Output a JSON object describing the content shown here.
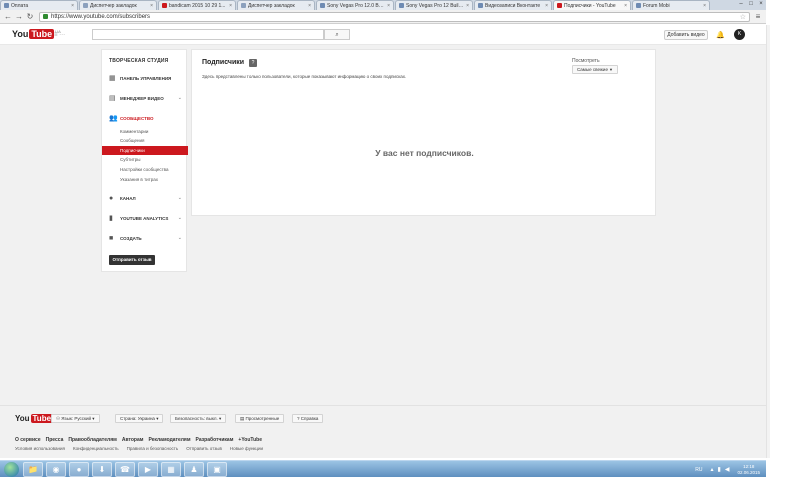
{
  "browser": {
    "tabs": [
      {
        "label": "Оплата",
        "icon": "generic",
        "active": false
      },
      {
        "label": "Диспетчер закладок",
        "icon": "star",
        "active": false
      },
      {
        "label": "bandicam 2015 10 29 1...",
        "icon": "yt",
        "active": false
      },
      {
        "label": "Диспетчер закладок",
        "icon": "star",
        "active": false
      },
      {
        "label": "Sony Vegas Pro 12.0 Build...",
        "icon": "generic",
        "active": false
      },
      {
        "label": "Sony Vegas Pro 12 Build...",
        "icon": "generic",
        "active": false
      },
      {
        "label": "Видеозаписи Вконтакте",
        "icon": "generic",
        "active": false
      },
      {
        "label": "Подписчики - YouTube",
        "icon": "yt",
        "active": true
      },
      {
        "label": "Forum Mobi",
        "icon": "generic",
        "active": false
      }
    ],
    "url": "https://www.youtube.com/subscribers",
    "tab_close": "×"
  },
  "masthead": {
    "logo_you": "You",
    "logo_tube": "Tube",
    "logo_region": "UA",
    "guide": "≡ ···",
    "search_icon": "⌕",
    "upload_label": "Добавить видео",
    "bell_icon": "🔔",
    "avatar_letter": "K"
  },
  "sidebar": {
    "studio_title": "ТВОРЧЕСКАЯ СТУДИЯ",
    "sections": [
      {
        "label": "ПАНЕЛЬ УПРАВЛЕНИЯ",
        "icon": "dashboard-icon",
        "glyph": "▦",
        "chevron": ""
      },
      {
        "label": "МЕНЕДЖЕР ВИДЕО",
        "icon": "video-manager-icon",
        "glyph": "▤",
        "chevron": "⌄"
      },
      {
        "label": "СООБЩЕСТВО",
        "icon": "community-icon",
        "glyph": "👥",
        "chevron": ""
      },
      {
        "label": "КАНАЛ",
        "icon": "channel-icon",
        "glyph": "●",
        "chevron": "⌄"
      },
      {
        "label": "YOUTUBE ANALYTICS",
        "icon": "analytics-icon",
        "glyph": "▮",
        "chevron": "⌄"
      },
      {
        "label": "СОЗДАТЬ",
        "icon": "create-icon",
        "glyph": "■",
        "chevron": "⌄"
      }
    ],
    "community_items": [
      {
        "label": "Комментарии",
        "active": false
      },
      {
        "label": "Сообщения",
        "active": false
      },
      {
        "label": "Подписчики",
        "active": true
      },
      {
        "label": "Субтитры",
        "active": false
      },
      {
        "label": "Настройки сообщества",
        "active": false
      },
      {
        "label": "Указания в титрах",
        "active": false
      }
    ],
    "feedback_button": "Отправить отзыв"
  },
  "main": {
    "title": "Подписчики",
    "help_badge": "?",
    "description": "Здесь представлены только пользователи, которые показывают информацию о своих подписках.",
    "sort_label": "Посмотреть",
    "sort_value": "Самые свежие",
    "empty_message": "У вас нет подписчиков."
  },
  "footer": {
    "logo_you": "You",
    "logo_tube": "Tube",
    "language_button": "Язык: Русский",
    "country_button": "Страна: Украина",
    "safety_button": "Безопасность: выкл.",
    "history_button": "Просмотренные",
    "help_button": "Справка",
    "links": [
      "О сервисе",
      "Пресса",
      "Правообладателям",
      "Авторам",
      "Рекламодателям",
      "Разработчикам",
      "+YouTube"
    ],
    "links2": [
      "Условия использования",
      "Конфиденциальность",
      "Правила и безопасность",
      "Отправить отзыв",
      "Новые функции"
    ]
  },
  "taskbar": {
    "apps": [
      "📁",
      "◉",
      "●",
      "⬇",
      "☎",
      "▶",
      "▦",
      "♟",
      "▣"
    ],
    "lang": "RU",
    "time": "12:18",
    "date": "02.06.2015"
  },
  "colors": {
    "accent": "#cc181e",
    "page_bg": "#f1f1f1"
  }
}
